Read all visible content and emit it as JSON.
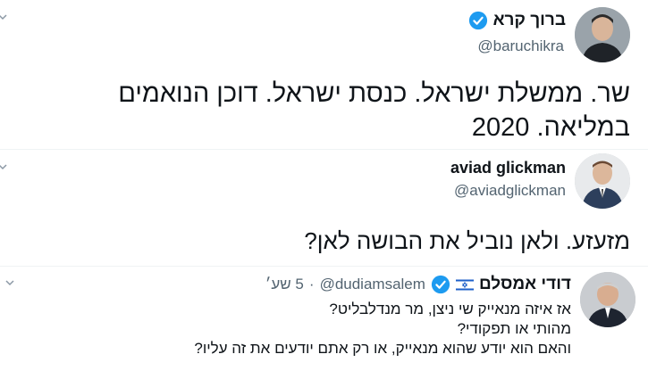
{
  "tweets": [
    {
      "display_name": "ברוך קרא",
      "handle": "@baruchikra",
      "verified": true,
      "text": "שר. ממשלת ישראל. כנסת ישראל. דוכן הנואמים במליאה. 2020"
    },
    {
      "display_name": "aviad glickman",
      "handle": "@aviadglickman",
      "verified": false,
      "text": "מזעזע. ולאן נוביל את הבושה לאן?"
    },
    {
      "display_name": "דודי אמסלם",
      "handle": "@dudiamsalem",
      "verified": true,
      "has_flag": true,
      "separator": "·",
      "time": "5 שע׳",
      "lines": [
        "אז איזה מנאייק שי ניצן, מר מנדלבליט?",
        "מהותי או תפקודי?",
        "והאם הוא יודע שהוא מנאייק, או רק אתם יודעים את זה עליו?"
      ]
    }
  ],
  "colors": {
    "verified_blue": "#1d9bf0",
    "text_primary": "#0f1419",
    "text_secondary": "#536471"
  },
  "icons": [
    "chevron-down-icon",
    "verified-badge-icon",
    "israel-flag-icon"
  ]
}
